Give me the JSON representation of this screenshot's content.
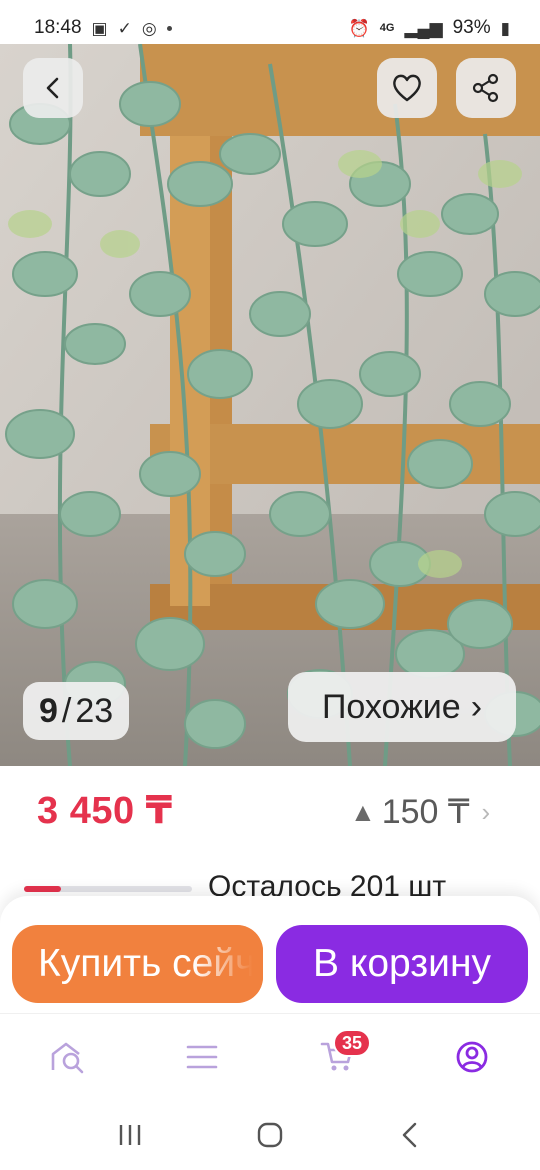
{
  "status_bar": {
    "time": "18:48",
    "network": "4G",
    "battery": "93%"
  },
  "gallery": {
    "current": "9",
    "separator": "/",
    "total": "23",
    "similar_label": "Похожие",
    "similar_chevron": "›"
  },
  "price": {
    "value": "3 450 ₸",
    "bonus_icon": "▲",
    "bonus_value": "150 ₸",
    "bonus_chevron": "›"
  },
  "stock": {
    "text": "Осталось 201 шт",
    "fill_fraction": 0.22
  },
  "actions": {
    "buy_now": "Купить сейчас",
    "add_to_cart": "В корзину"
  },
  "bottom_nav": {
    "cart_badge": "35"
  },
  "colors": {
    "price": "#e5324d",
    "buy": "#f1813e",
    "cart": "#8a2be2",
    "profile_active": "#8a2be2"
  },
  "icons": [
    "back-icon",
    "heart-icon",
    "share-icon",
    "search-icon",
    "catalog-icon",
    "cart-icon",
    "profile-icon"
  ]
}
